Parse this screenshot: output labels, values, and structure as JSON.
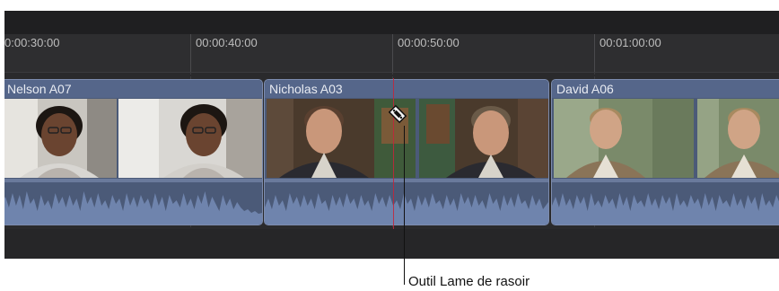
{
  "ruler": {
    "timecodes": [
      "0:00:30:00",
      "00:00:40:00",
      "00:00:50:00",
      "00:01:00:00"
    ]
  },
  "clips": [
    {
      "name": "Nelson A07"
    },
    {
      "name": "Nicholas A03"
    },
    {
      "name": "David A06"
    }
  ],
  "tool": {
    "icon": "blade-icon",
    "callout": "Outil Lame de rasoir"
  },
  "colors": {
    "timeline_bg": "#2a2a2c",
    "clip_fill": "#4b5a78",
    "clip_header": "#55668a",
    "playhead": "#c4243a"
  }
}
